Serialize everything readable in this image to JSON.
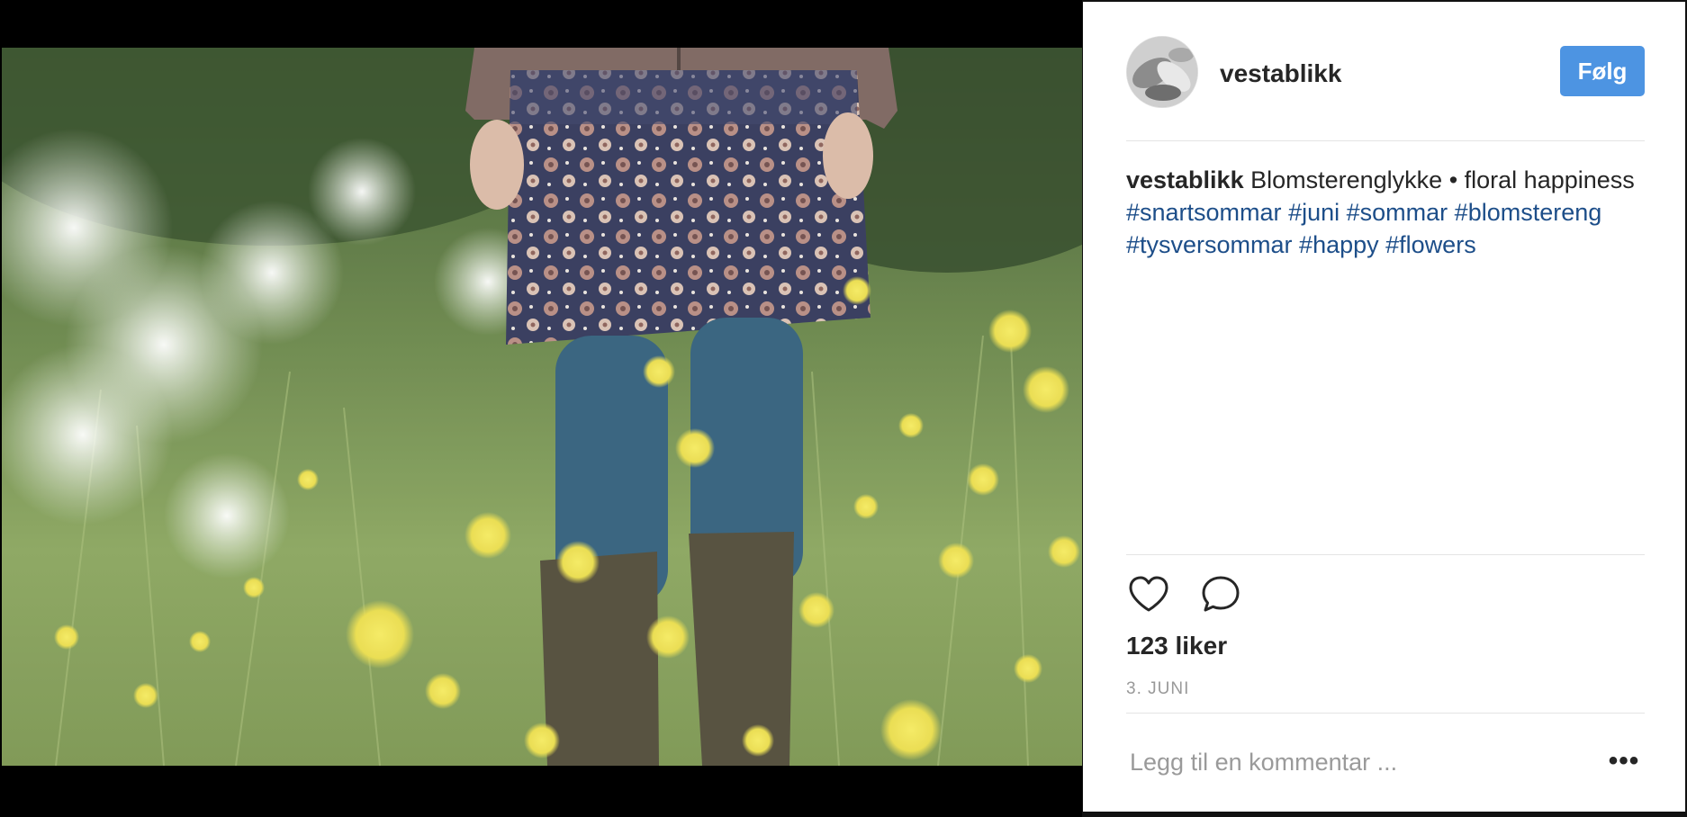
{
  "post": {
    "username": "vestablikk",
    "follow_label": "Følg",
    "caption_user": "vestablikk",
    "caption_text": "Blomsterenglykke • floral happiness",
    "hashtags": [
      "#snartsommar",
      "#juni",
      "#sommar",
      "#blomstereng",
      "#tysversommar",
      "#happy",
      "#flowers"
    ],
    "likes": "123 liker",
    "date": "3. JUNI",
    "comment_placeholder": "Legg til en kommentar ...",
    "more_label": "•••"
  },
  "icons": {
    "like": "heart-icon",
    "comment": "comment-bubble-icon",
    "more": "more-options-icon"
  },
  "colors": {
    "follow_button": "#4d94e2",
    "hashtag": "#1d4e89",
    "text": "#262626",
    "muted": "#999999"
  }
}
